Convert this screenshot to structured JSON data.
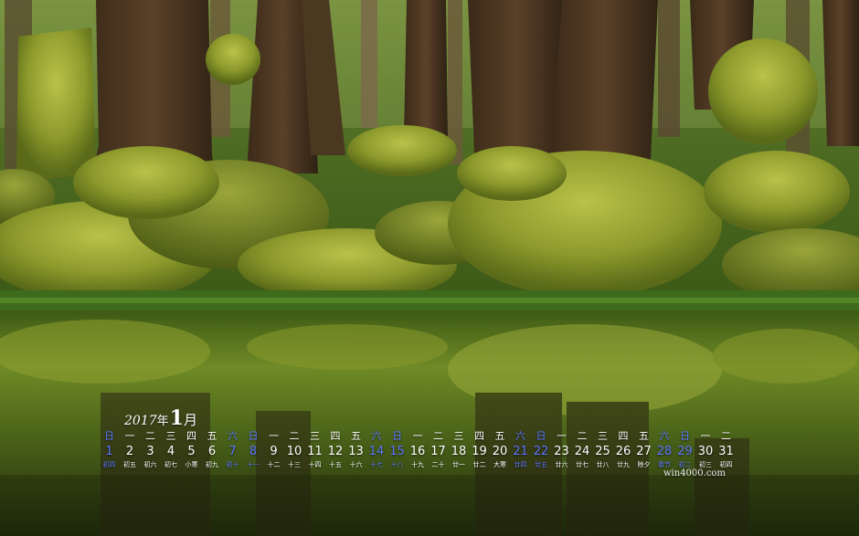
{
  "calendar": {
    "year": "2017",
    "year_char": "年",
    "month": "1",
    "month_char": "月",
    "weekdays": [
      "日",
      "一",
      "二",
      "三",
      "四",
      "五",
      "六",
      "日",
      "一",
      "二",
      "三",
      "四",
      "五",
      "六",
      "日",
      "一",
      "二",
      "三",
      "四",
      "五",
      "六",
      "日",
      "一",
      "二",
      "三",
      "四",
      "五",
      "六",
      "日",
      "一",
      "二"
    ],
    "days": [
      "1",
      "2",
      "3",
      "4",
      "5",
      "6",
      "7",
      "8",
      "9",
      "10",
      "11",
      "12",
      "13",
      "14",
      "15",
      "16",
      "17",
      "18",
      "19",
      "20",
      "21",
      "22",
      "23",
      "24",
      "25",
      "26",
      "27",
      "28",
      "29",
      "30",
      "31"
    ],
    "lunar": [
      "初四",
      "初五",
      "初六",
      "初七",
      "小寒",
      "初九",
      "初十",
      "十一",
      "十二",
      "十三",
      "十四",
      "十五",
      "十六",
      "十七",
      "十八",
      "十九",
      "二十",
      "廿一",
      "廿二",
      "大寒",
      "廿四",
      "廿五",
      "廿六",
      "廿七",
      "廿八",
      "廿九",
      "除夕",
      "春节",
      "初二",
      "初三",
      "初四"
    ],
    "weekend_color": "#5d76ff",
    "text_color": "#ffffff"
  },
  "watermark": "win4000.com"
}
